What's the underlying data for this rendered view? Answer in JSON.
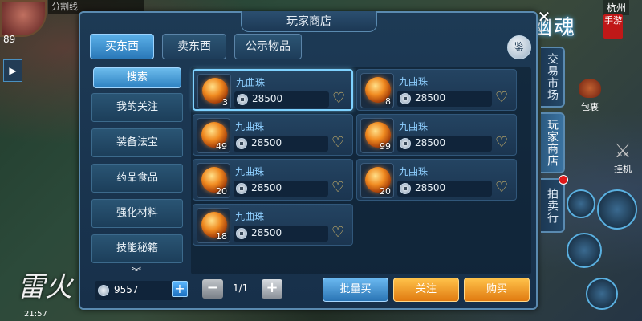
{
  "hud": {
    "top_text": "分割线",
    "level": "89",
    "city": "杭州",
    "game_logo": "倩女幽魂",
    "logo_seal": "手游",
    "mode_label": "雷火",
    "time": "21:57",
    "bag_label": "包裹",
    "hang_label": "挂机"
  },
  "panel": {
    "title": "玩家商店",
    "appraise_label": "鉴",
    "tabs": [
      {
        "label": "买东西",
        "active": true
      },
      {
        "label": "卖东西",
        "active": false
      },
      {
        "label": "公示物品",
        "active": false
      }
    ],
    "search_label": "搜索",
    "categories": [
      "我的关注",
      "装备法宝",
      "药品食品",
      "强化材料",
      "技能秘籍"
    ]
  },
  "items": [
    {
      "name": "九曲珠",
      "qty": "3",
      "price": "28500",
      "selected": true
    },
    {
      "name": "九曲珠",
      "qty": "8",
      "price": "28500",
      "selected": false
    },
    {
      "name": "九曲珠",
      "qty": "49",
      "price": "28500",
      "selected": false
    },
    {
      "name": "九曲珠",
      "qty": "99",
      "price": "28500",
      "selected": false
    },
    {
      "name": "九曲珠",
      "qty": "20",
      "price": "28500",
      "selected": false
    },
    {
      "name": "九曲珠",
      "qty": "20",
      "price": "28500",
      "selected": false
    },
    {
      "name": "九曲珠",
      "qty": "18",
      "price": "28500",
      "selected": false
    }
  ],
  "footer": {
    "money": "9557",
    "page": "1/1",
    "bulk_buy_label": "批量买",
    "follow_label": "关注",
    "buy_label": "购买"
  },
  "side_tabs": [
    {
      "label": "交易市场",
      "active": false
    },
    {
      "label": "玩家商店",
      "active": true
    },
    {
      "label": "拍卖行",
      "active": false
    }
  ],
  "colors": {
    "panel_bg": "#1d3a55",
    "accent_blue": "#5bb0e8",
    "accent_orange": "#f0a020",
    "item_name": "#8ecfff",
    "heart": "#e8c56a"
  }
}
